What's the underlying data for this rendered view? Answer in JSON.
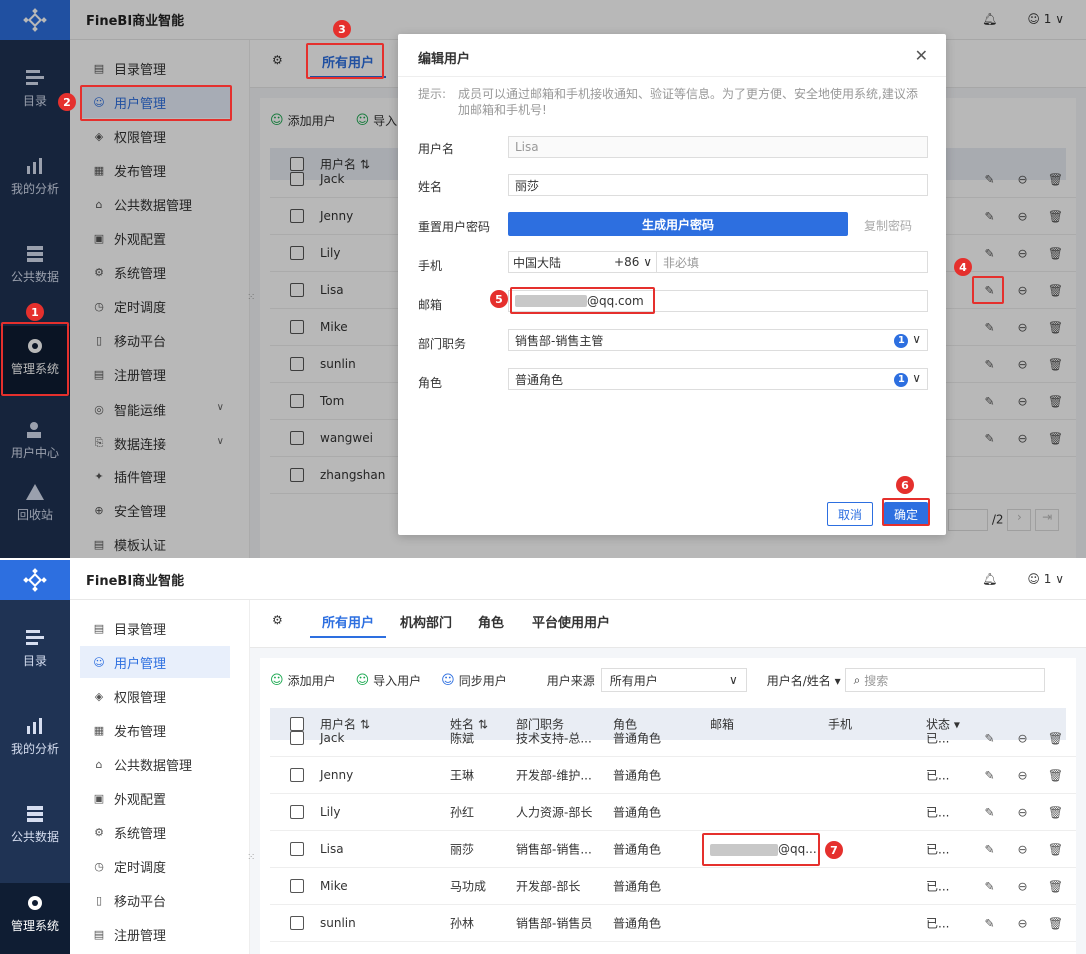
{
  "app": {
    "title": "FineBI商业智能",
    "user": "1"
  },
  "rail": [
    {
      "label": "目录",
      "icon": "catalog-icon"
    },
    {
      "label": "我的分析",
      "icon": "analysis-icon"
    },
    {
      "label": "公共数据",
      "icon": "public-data-icon"
    },
    {
      "label": "管理系统",
      "icon": "manage-system-icon"
    },
    {
      "label": "用户中心",
      "icon": "user-center-icon"
    },
    {
      "label": "回收站",
      "icon": "recycle-icon"
    }
  ],
  "menu": [
    {
      "label": "目录管理",
      "icon": "catalog-manage-icon"
    },
    {
      "label": "用户管理",
      "icon": "user-manage-icon"
    },
    {
      "label": "权限管理",
      "icon": "permission-icon"
    },
    {
      "label": "发布管理",
      "icon": "publish-icon"
    },
    {
      "label": "公共数据管理",
      "icon": "public-data-manage-icon"
    },
    {
      "label": "外观配置",
      "icon": "appearance-icon"
    },
    {
      "label": "系统管理",
      "icon": "system-icon"
    },
    {
      "label": "定时调度",
      "icon": "schedule-icon"
    },
    {
      "label": "移动平台",
      "icon": "mobile-icon"
    },
    {
      "label": "注册管理",
      "icon": "register-icon"
    },
    {
      "label": "智能运维",
      "icon": "ops-icon"
    },
    {
      "label": "数据连接",
      "icon": "data-connect-icon"
    },
    {
      "label": "插件管理",
      "icon": "plugin-icon"
    },
    {
      "label": "安全管理",
      "icon": "security-icon"
    },
    {
      "label": "模板认证",
      "icon": "template-auth-icon"
    }
  ],
  "tabs": [
    "所有用户",
    "机构部门",
    "角色",
    "平台使用用户"
  ],
  "toolbar": {
    "add": "添加用户",
    "import": "导入用户",
    "import_short": "导入",
    "sync": "同步用户",
    "source_label": "用户来源",
    "source_value": "所有用户",
    "search_field": "用户名/姓名",
    "search_placeholder": "搜索"
  },
  "columns": {
    "username": "用户名",
    "name": "姓名",
    "dept": "部门职务",
    "role": "角色",
    "email": "邮箱",
    "phone": "手机",
    "status": "状态"
  },
  "users_top": [
    "Jack",
    "Jenny",
    "Lily",
    "Lisa",
    "Mike",
    "sunlin",
    "Tom",
    "wangwei",
    "zhangshan"
  ],
  "rows": [
    {
      "username": "Jack",
      "name": "陈斌",
      "dept": "技术支持-总...",
      "role": "普通角色",
      "email": "",
      "status": "已..."
    },
    {
      "username": "Jenny",
      "name": "王琳",
      "dept": "开发部-维护...",
      "role": "普通角色",
      "email": "",
      "status": "已..."
    },
    {
      "username": "Lily",
      "name": "孙红",
      "dept": "人力资源-部长",
      "role": "普通角色",
      "email": "",
      "status": "已..."
    },
    {
      "username": "Lisa",
      "name": "丽莎",
      "dept": "销售部-销售...",
      "role": "普通角色",
      "email": "@qq...",
      "status": "已..."
    },
    {
      "username": "Mike",
      "name": "马功成",
      "dept": "开发部-部长",
      "role": "普通角色",
      "email": "",
      "status": "已..."
    },
    {
      "username": "sunlin",
      "name": "孙林",
      "dept": "销售部-销售员",
      "role": "普通角色",
      "email": "",
      "status": "已..."
    }
  ],
  "pager": {
    "total": "/2"
  },
  "dialog": {
    "title": "编辑用户",
    "tip_label": "提示:",
    "tip_text": "成员可以通过邮箱和手机接收通知、验证等信息。为了更方便、安全地使用系统,建议添加邮箱和手机号!",
    "username_label": "用户名",
    "username_value": "Lisa",
    "name_label": "姓名",
    "name_value": "丽莎",
    "reset_pwd_label": "重置用户密码",
    "gen_pwd": "生成用户密码",
    "copy_pwd": "复制密码",
    "phone_label": "手机",
    "phone_region": "中国大陆",
    "phone_code": "+86",
    "phone_placeholder": "非必填",
    "email_label": "邮箱",
    "email_value": "@qq.com",
    "dept_label": "部门职务",
    "dept_value": "销售部-销售主管",
    "dept_count": "1",
    "role_label": "角色",
    "role_value": "普通角色",
    "role_count": "1",
    "cancel": "取消",
    "ok": "确定"
  },
  "markers": [
    "1",
    "2",
    "3",
    "4",
    "5",
    "6",
    "7"
  ],
  "colors": {
    "accent": "#2d6fe0",
    "marker": "#e5302d",
    "rail": "#1f3354"
  }
}
